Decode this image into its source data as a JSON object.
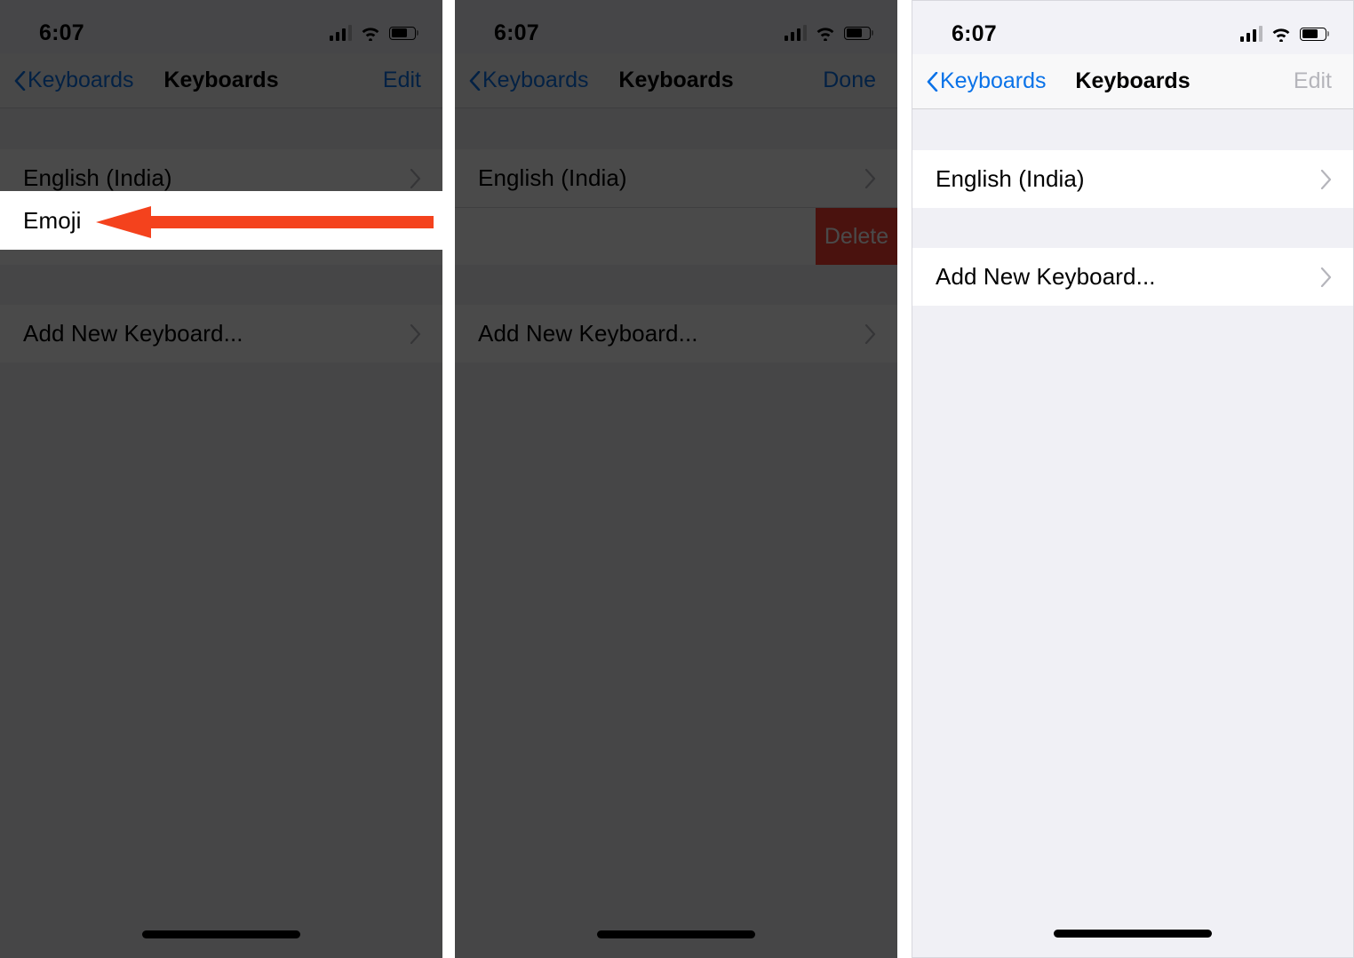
{
  "meta": {
    "platform": "iOS Settings",
    "screen": "Keyboards",
    "accent_blue": "#0a72e8",
    "delete_red": "#ff3b30",
    "annotation_orange": "#f4421d",
    "dim_gray": "#4a4a4a"
  },
  "status_bar": {
    "time": "6:07",
    "cellular_icon": "cellular-signal-icon",
    "wifi_icon": "wifi-icon",
    "battery_icon": "battery-icon",
    "battery_level_percent": 70,
    "signal_bars": 4,
    "signal_bars_active": 3
  },
  "panels": [
    {
      "id": "panel-1",
      "dimmed": true,
      "nav": {
        "back_label": "Keyboards",
        "title": "Keyboards",
        "action_label": "Edit",
        "action_disabled": false,
        "back_icon": "chevron-left-icon"
      },
      "rows": [
        {
          "label": "English (India)",
          "accessory": "chevron-right-icon",
          "highlighted": false
        },
        {
          "label": "Emoji",
          "accessory": "",
          "highlighted": true
        }
      ],
      "footer_rows": [
        {
          "label": "Add New Keyboard...",
          "accessory": "chevron-right-icon"
        }
      ],
      "annotation": {
        "type": "arrow-left",
        "color": "#f4421d",
        "points_at": "Emoji"
      }
    },
    {
      "id": "panel-2",
      "dimmed": true,
      "nav": {
        "back_label": "Keyboards",
        "title": "Keyboards",
        "action_label": "Done",
        "action_disabled": false,
        "back_icon": "chevron-left-icon"
      },
      "rows": [
        {
          "label": "English (India)",
          "accessory": "chevron-right-icon",
          "highlighted": false
        },
        {
          "label": "",
          "accessory": "",
          "swiped": true,
          "delete_label": "Delete"
        }
      ],
      "footer_rows": [
        {
          "label": "Add New Keyboard...",
          "accessory": "chevron-right-icon"
        }
      ]
    },
    {
      "id": "panel-3",
      "dimmed": false,
      "nav": {
        "back_label": "Keyboards",
        "title": "Keyboards",
        "action_label": "Edit",
        "action_disabled": true,
        "back_icon": "chevron-left-icon"
      },
      "rows": [
        {
          "label": "English (India)",
          "accessory": "chevron-right-icon",
          "highlighted": false
        }
      ],
      "footer_rows": [
        {
          "label": "Add New Keyboard...",
          "accessory": "chevron-right-icon"
        }
      ]
    }
  ]
}
